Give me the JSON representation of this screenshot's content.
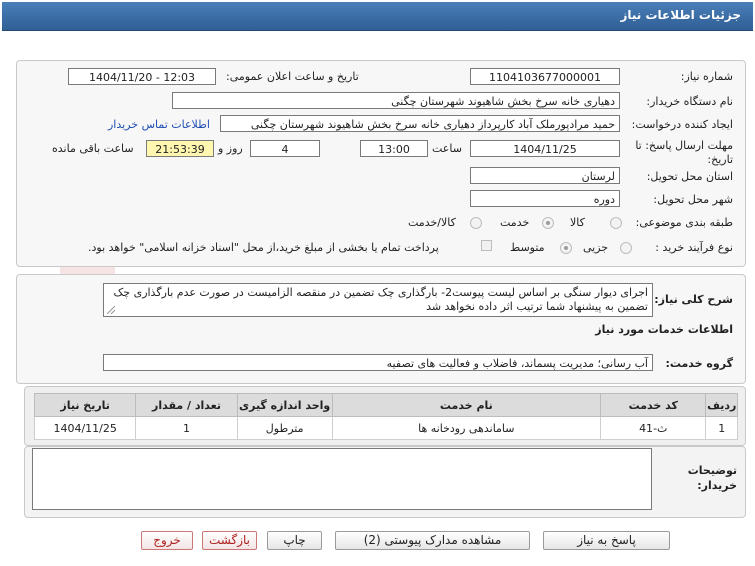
{
  "window": {
    "title": "جزئیات اطلاعات نیاز"
  },
  "watermark": {
    "brand": "AriaTender.net"
  },
  "form": {
    "need_number_label": "شماره نیاز:",
    "need_number": "1104103677000001",
    "announce_label": "تاریخ و ساعت اعلان عمومی:",
    "announce_value": "1404/11/20 - 12:03",
    "buyer_org_label": "نام دستگاه خریدار:",
    "buyer_org": "دهیاری خانه سرخ بخش شاهیوند شهرستان چگنی",
    "requester_label": "ایجاد کننده درخواست:",
    "requester": "حمید مرادپورملک آباد کارپرداز دهیاری خانه سرخ بخش شاهیوند شهرستان چگنی",
    "contact_link": "اطلاعات تماس خریدار",
    "deadline_label": "مهلت ارسال پاسخ: تا تاریخ:",
    "deadline_date": "1404/11/25",
    "time_label": "ساعت",
    "deadline_time": "13:00",
    "days_value": "4",
    "days_label": "روز و",
    "remaining_time": "21:53:39",
    "remaining_label": "ساعت باقی مانده",
    "province_label": "استان محل تحویل:",
    "province": "لرستان",
    "city_label": "شهر محل تحویل:",
    "city": "دوره",
    "category_label": "طبقه بندی موضوعی:",
    "category_options": [
      "کالا",
      "خدمت",
      "کالا/خدمت"
    ],
    "category_selected": "خدمت",
    "process_label": "نوع فرآیند خرید :",
    "process_options": [
      "جزیی",
      "متوسط"
    ],
    "process_selected": "متوسط",
    "payment_note": "پرداخت تمام یا بخشی از مبلغ خرید،از محل \"اسناد خزانه اسلامی\" خواهد بود."
  },
  "description": {
    "label": "شرح کلی نیاز:",
    "text": "اجرای دیوار سنگی بر اساس لیست پیوست2- بارگذاری چک تضمین در منقصه الزامیست در صورت عدم بارگذاری چک تضمین به پیشنهاد شما ترتیب اثر داده نخواهد شد"
  },
  "services": {
    "section_title": "اطلاعات خدمات مورد نیاز",
    "group_label": "گروه خدمت:",
    "group_value": "آب رسانی؛ مدیریت پسماند، فاضلاب و فعالیت های تصفیه",
    "columns": [
      "ردیف",
      "کد خدمت",
      "نام خدمت",
      "واحد اندازه گیری",
      "تعداد / مقدار",
      "تاریخ نیاز"
    ],
    "rows": [
      {
        "row": "1",
        "code": "ث-41",
        "name": "ساماندهی رودخانه ها",
        "unit": "مترطول",
        "qty": "1",
        "date": "1404/11/25"
      }
    ]
  },
  "buyer_notes": {
    "label": "توضیحات خریدار:",
    "text": ""
  },
  "buttons": {
    "reply": "پاسخ به نیاز",
    "attachments": "مشاهده مدارک پیوستی (2)",
    "print": "چاپ",
    "back": "بازگشت",
    "exit": "خروج"
  },
  "colors": {
    "titlebar": "#3a6ea5",
    "link": "#1f4fb3",
    "remaining_bg": "#fff7b0"
  }
}
